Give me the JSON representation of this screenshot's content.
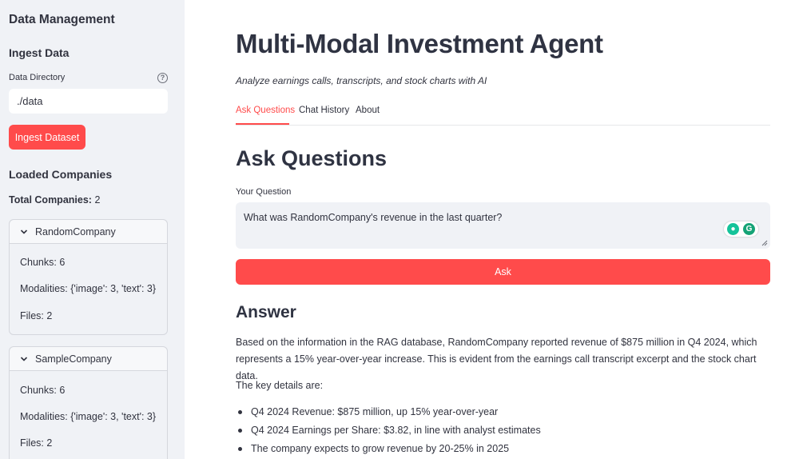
{
  "sidebar": {
    "title": "Data Management",
    "ingest_heading": "Ingest Data",
    "dir_label": "Data Directory",
    "dir_value": "./data",
    "help_icon": "question-circle-icon",
    "ingest_button": "Ingest Dataset",
    "loaded_heading": "Loaded Companies",
    "total_label": "Total Companies:",
    "total_value": "2",
    "companies": [
      {
        "name": "RandomCompany",
        "chunks": "Chunks: 6",
        "modalities": "Modalities: {'image': 3, 'text': 3}",
        "files": "Files: 2"
      },
      {
        "name": "SampleCompany",
        "chunks": "Chunks: 6",
        "modalities": "Modalities: {'image': 3, 'text': 3}",
        "files": "Files: 2"
      }
    ]
  },
  "main": {
    "title": "Multi-Modal Investment Agent",
    "caption": "Analyze earnings calls, transcripts, and stock charts with AI",
    "tabs": [
      "Ask Questions",
      "Chat History",
      "About"
    ],
    "active_tab": "Ask Questions",
    "section_heading": "Ask Questions",
    "question_label": "Your Question",
    "question_value": "What was RandomCompany's revenue in the last quarter?",
    "ask_button": "Ask",
    "answer_heading": "Answer",
    "answer_lines": [
      "Based on the information in the RAG database, RandomCompany reported revenue of $875 million in Q4 2024, which",
      "represents a 15% year-over-year increase. This is evident from the earnings call transcript excerpt and the stock chart data.",
      "The key details are:"
    ],
    "bullets": [
      "Q4 2024 Revenue: $875 million, up 15% year-over-year",
      "Q4 2024 Earnings per Share: $3.82, in line with analyst estimates",
      "The company expects to grow revenue by 20-25% in 2025"
    ]
  },
  "colors": {
    "accent": "#ff4b4b",
    "sidebar_bg": "#f0f2f6",
    "text": "#31333f",
    "grammarly_green": "#15c39a"
  }
}
